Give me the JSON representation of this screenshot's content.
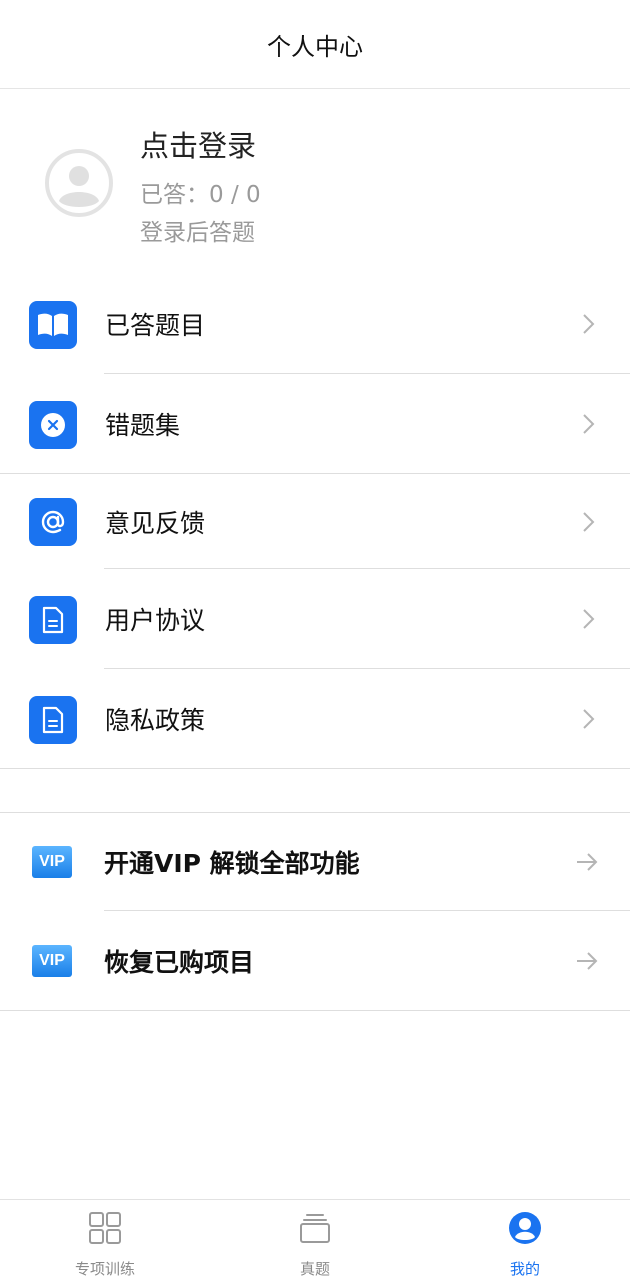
{
  "header": {
    "title": "个人中心"
  },
  "profile": {
    "login_title": "点击登录",
    "answered": "已答：0 / 0",
    "hint": "登录后答题"
  },
  "menu": [
    {
      "label": "已答题目",
      "icon": "open-book-icon"
    },
    {
      "label": "错题集",
      "icon": "close-circle-icon"
    },
    {
      "label": "意见反馈",
      "icon": "at-sign-icon"
    },
    {
      "label": "用户协议",
      "icon": "document-icon"
    },
    {
      "label": "隐私政策",
      "icon": "document-icon"
    }
  ],
  "vip": [
    {
      "badge": "VIP",
      "label": "开通VIP 解锁全部功能"
    },
    {
      "badge": "VIP",
      "label": "恢复已购项目"
    }
  ],
  "tabs": [
    {
      "label": "专项训练",
      "icon": "grid-icon"
    },
    {
      "label": "真题",
      "icon": "stack-icon"
    },
    {
      "label": "我的",
      "icon": "user-circle-icon",
      "active": true
    }
  ],
  "colors": {
    "accent": "#1a73f0",
    "muted": "#9a9a9a"
  }
}
